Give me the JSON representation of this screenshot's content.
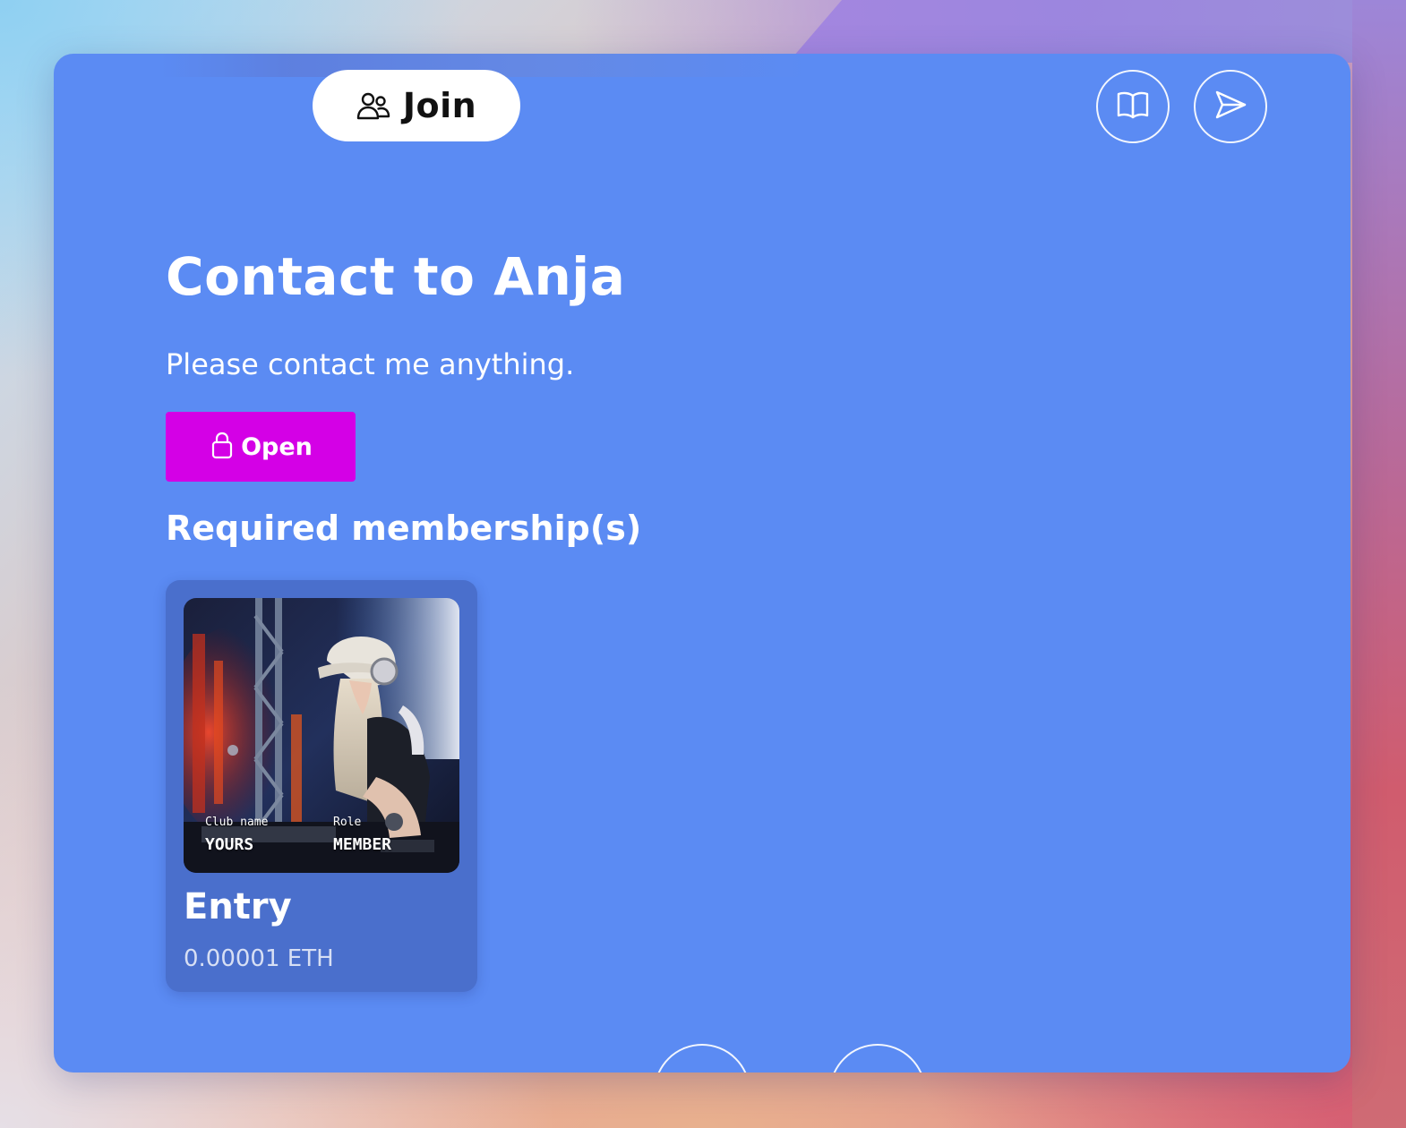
{
  "header": {
    "join_label": "Join",
    "join_icon": "users-icon",
    "book_icon": "book-open-icon",
    "send_icon": "send-icon"
  },
  "main": {
    "title": "Contact to Anja",
    "description": "Please contact me anything.",
    "open_button": {
      "label": "Open",
      "icon": "lock-icon",
      "color": "#d400e6"
    },
    "required_heading": "Required membership(s)"
  },
  "memberships": [
    {
      "club_name_label": "Club name",
      "club_name_value": "YOURS",
      "role_label": "Role",
      "role_value": "MEMBER",
      "name": "Entry",
      "price": "0.00001 ETH"
    }
  ],
  "colors": {
    "card_background": "#5b8bf3",
    "membership_card_background": "#4a6fcc",
    "accent": "#d400e6"
  }
}
